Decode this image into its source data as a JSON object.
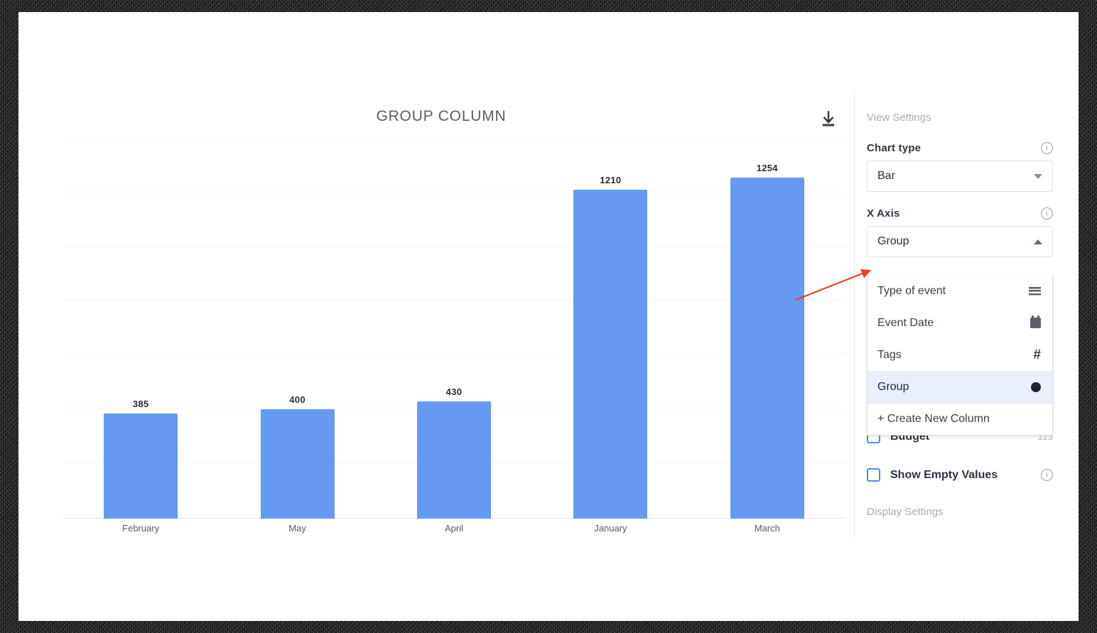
{
  "chart_panel": {
    "title": "GROUP COLUMN",
    "download_icon": "download-icon"
  },
  "chart_data": {
    "type": "bar",
    "title": "GROUP COLUMN",
    "xlabel": "",
    "ylabel": "",
    "categories": [
      "February",
      "May",
      "April",
      "January",
      "March"
    ],
    "values": [
      385,
      400,
      430,
      1210,
      1254
    ],
    "value_labels": [
      "385",
      "400",
      "430",
      "1210",
      "1254"
    ],
    "series": [
      {
        "name": "Group",
        "values": [
          385,
          400,
          430,
          1210,
          1254
        ]
      }
    ],
    "ylim": [
      0,
      1400
    ],
    "grid": true,
    "gridlines": [
      1400,
      1200,
      1000,
      800,
      600,
      400,
      200
    ],
    "legend": "none",
    "bar_color": "#6699f2"
  },
  "sidebar": {
    "view_settings_label": "View Settings",
    "chart_type": {
      "label": "Chart type",
      "value": "Bar",
      "info_icon": "info-icon",
      "caret_icon": "chevron-down-icon"
    },
    "x_axis": {
      "label": "X Axis",
      "value": "Group",
      "info_icon": "info-icon",
      "caret_icon": "chevron-up-icon",
      "open": true,
      "options": [
        {
          "label": "Type of event",
          "icon": "hamburger-icon",
          "icon_glyph": "≡",
          "selected": false
        },
        {
          "label": "Event Date",
          "icon": "calendar-icon",
          "icon_glyph": "",
          "selected": false
        },
        {
          "label": "Tags",
          "icon": "hash-icon",
          "icon_glyph": "#",
          "selected": false
        },
        {
          "label": "Group",
          "icon": "dot-icon",
          "icon_glyph": "●",
          "selected": true
        },
        {
          "label": "+ Create New Column",
          "icon": "",
          "icon_glyph": "",
          "selected": false
        }
      ]
    },
    "budget_row": {
      "label": "Budget",
      "hint": "123",
      "checked": false
    },
    "show_empty_values": {
      "label": "Show Empty Values",
      "checked": false,
      "info_icon": "info-icon"
    },
    "display_settings_label": "Display Settings"
  },
  "annotation": {
    "arrow_color": "#ef3b21"
  },
  "colors": {
    "bar": "#6699f2",
    "accent_blue": "#4b8cf5",
    "highlight": "#e9f0fb",
    "text_dark": "#2c3645",
    "text_muted": "#a6adb4"
  }
}
